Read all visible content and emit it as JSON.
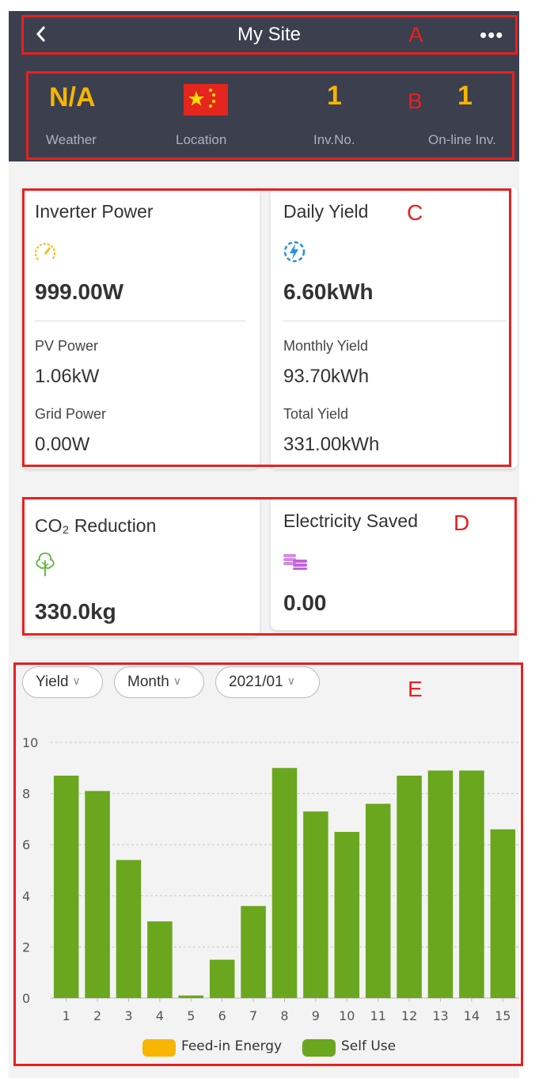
{
  "header": {
    "title": "My Site",
    "back_icon": "chevron-left-icon",
    "more_icon": "more-dots-icon",
    "more_text": "•••"
  },
  "stats": [
    {
      "value": "N/A",
      "label": "Weather"
    },
    {
      "value": "",
      "label": "Location",
      "icon": "china-flag-icon"
    },
    {
      "value": "1",
      "label": "Inv.No."
    },
    {
      "value": "1",
      "label": "On-line Inv."
    }
  ],
  "inverter_power": {
    "title": "Inverter Power",
    "icon": "speedometer-icon",
    "value": "999.00W",
    "pv_label": "PV Power",
    "pv_value": "1.06kW",
    "grid_label": "Grid Power",
    "grid_value": "0.00W"
  },
  "daily_yield": {
    "title": "Daily Yield",
    "icon": "lightning-circle-icon",
    "value": "6.60kWh",
    "monthly_label": "Monthly Yield",
    "monthly_value": "93.70kWh",
    "total_label": "Total Yield",
    "total_value": "331.00kWh"
  },
  "co2": {
    "title": "CO₂ Reduction",
    "icon": "tree-icon",
    "value": "330.0kg"
  },
  "electricity_saved": {
    "title": "Electricity Saved",
    "icon": "coins-icon",
    "value": "0.00"
  },
  "filters": {
    "type": "Yield",
    "period": "Month",
    "date": "2021/01",
    "chevron": "∨"
  },
  "annotations": {
    "a": "A",
    "b": "B",
    "c": "C",
    "d": "D",
    "e": "E"
  },
  "colors": {
    "header_bg": "#3b3f4e",
    "accent_yellow": "#f7b500",
    "self_use": "#6aa61e",
    "feed_in": "#f7b500",
    "annotation_red": "#e8201e"
  },
  "chart_data": {
    "type": "bar",
    "categories": [
      "1",
      "2",
      "3",
      "4",
      "5",
      "6",
      "7",
      "8",
      "9",
      "10",
      "11",
      "12",
      "13",
      "14",
      "15"
    ],
    "series": [
      {
        "name": "Feed-in Energy",
        "values": [
          0,
          0,
          0,
          0,
          0,
          0,
          0,
          0,
          0,
          0,
          0,
          0,
          0,
          0,
          0
        ]
      },
      {
        "name": "Self Use",
        "values": [
          8.7,
          8.1,
          5.4,
          3.0,
          0.1,
          1.5,
          3.6,
          9.0,
          7.3,
          6.5,
          7.6,
          8.7,
          8.9,
          8.9,
          6.6
        ]
      }
    ],
    "yticks": [
      "0",
      "2",
      "4",
      "6",
      "8",
      "10"
    ],
    "ylim": [
      0,
      10
    ],
    "grid": true,
    "legend": "bottom"
  }
}
